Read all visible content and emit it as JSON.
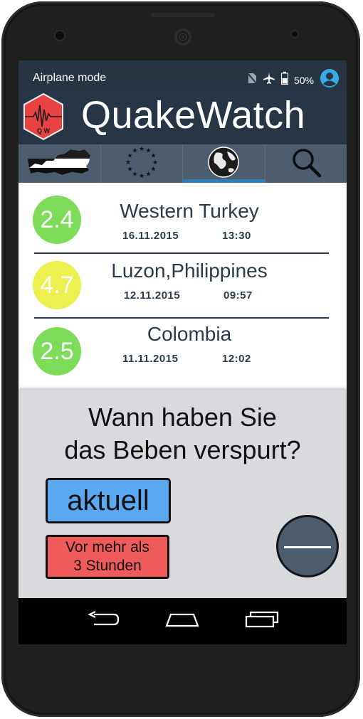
{
  "status_bar": {
    "mode_text": "Airplane mode",
    "battery_percent": "50%"
  },
  "app": {
    "title": "QuakeWatch",
    "logo_text": "Q W"
  },
  "tabs": [
    {
      "name": "austria",
      "icon": "austria-map-icon",
      "active": false
    },
    {
      "name": "europe",
      "icon": "eu-stars-icon",
      "active": false
    },
    {
      "name": "world",
      "icon": "globe-icon",
      "active": true
    },
    {
      "name": "search",
      "icon": "search-icon",
      "active": false
    }
  ],
  "earthquakes": [
    {
      "magnitude": "2.4",
      "place": "Western Turkey",
      "date": "16.11.2015",
      "time": "13:30",
      "color": "#7ddc5a"
    },
    {
      "magnitude": "4.7",
      "place": "Luzon,Philippines",
      "date": "12.11.2015",
      "time": "09:57",
      "color": "#eef050"
    },
    {
      "magnitude": "2.5",
      "place": "Colombia",
      "date": "11.11.2015",
      "time": "12:02",
      "color": "#7ddc5a"
    }
  ],
  "panel": {
    "question_line1": "Wann haben Sie",
    "question_line2": "das Beben verspurt?",
    "button_now": "aktuell",
    "button_older_line1": "Vor mehr als",
    "button_older_line2": "3 Stunden"
  },
  "colors": {
    "header_bg": "#273646",
    "tab_bg": "#4b5d6e",
    "tab_active_indicator": "#2f7db5",
    "now_button": "#5aa8ef",
    "older_button": "#ef5a5a"
  }
}
